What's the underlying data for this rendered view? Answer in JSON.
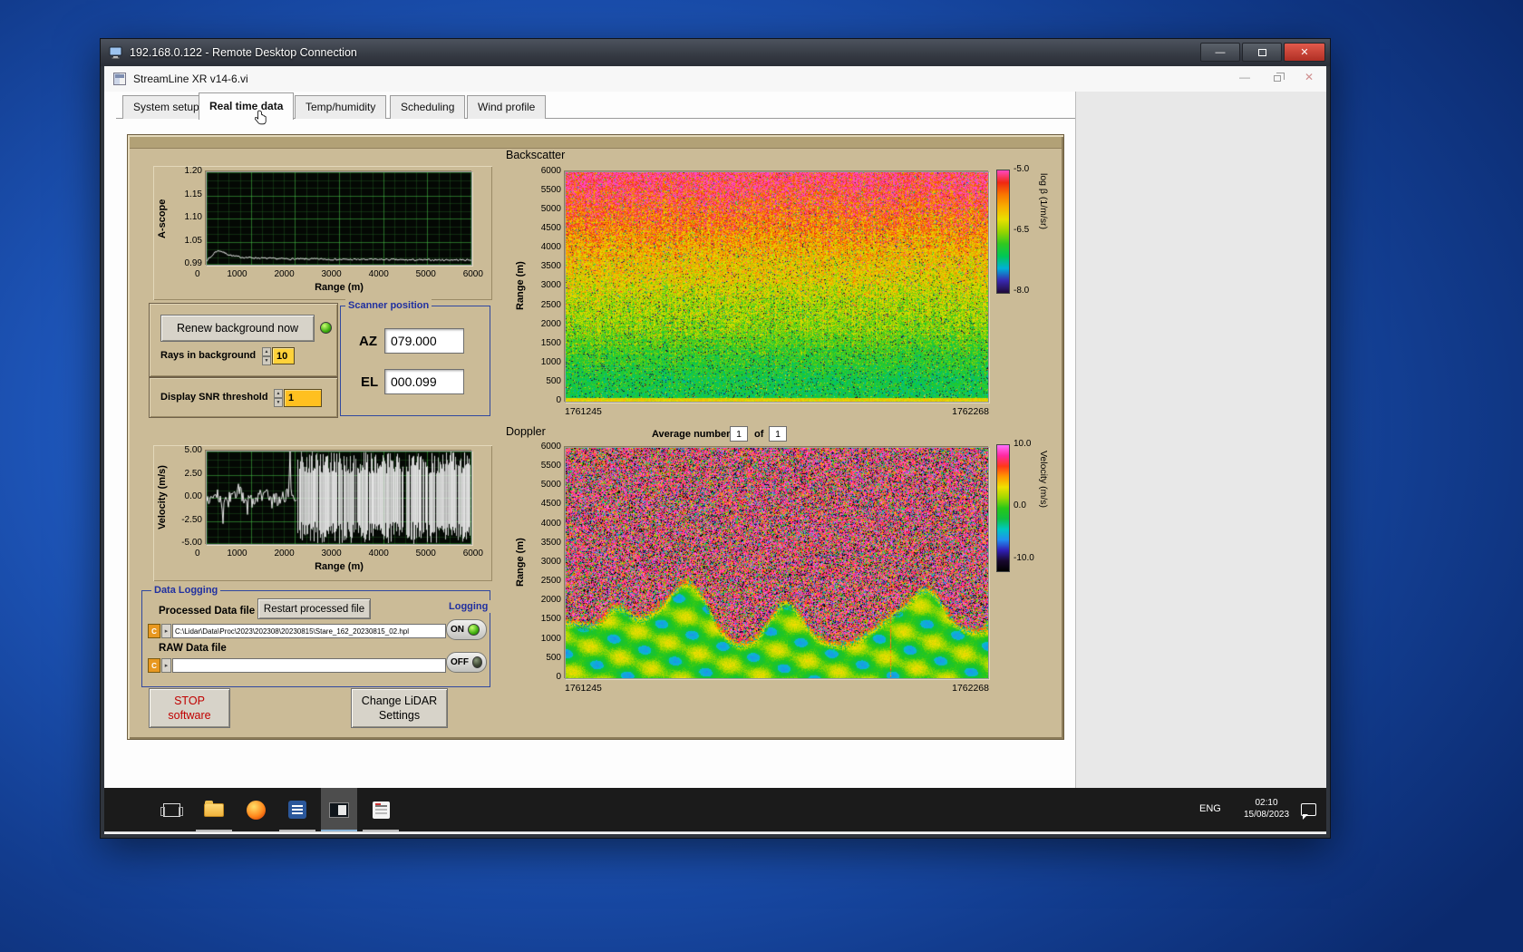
{
  "rdp": {
    "title": "192.168.0.122 - Remote Desktop Connection"
  },
  "app_window": {
    "title": "StreamLine XR v14-6.vi",
    "tabs": [
      "System setup",
      "Real time data",
      "Temp/humidity",
      "Scheduling",
      "Wind profile"
    ],
    "active_tab": "Real time data"
  },
  "panel": {
    "backscatter_title": "Backscatter",
    "doppler_title": "Doppler",
    "average_label": "Average number",
    "average_value": "1",
    "of_label": "of",
    "average_total": "1",
    "renew_button": "Renew background now",
    "rays_label": "Rays in background",
    "rays_value": "10",
    "snr_label": "Display SNR threshold",
    "snr_value": "1",
    "scanner": {
      "label": "Scanner position",
      "az_label": "AZ",
      "az_value": "079.000",
      "el_label": "EL",
      "el_value": "000.099"
    },
    "logging": {
      "box_label": "Data Logging",
      "processed_label": "Processed Data file",
      "restart_button": "Restart processed file",
      "logging_label": "Logging",
      "drive_letter": "C",
      "processed_path": "C:\\Lidar\\Data\\Proc\\2023\\202308\\20230815\\Stare_162_20230815_02.hpl",
      "raw_label": "RAW Data file",
      "raw_path": "",
      "on_label": "ON",
      "off_label": "OFF"
    },
    "stop_button_line1": "STOP",
    "stop_button_line2": "software",
    "change_button_line1": "Change LiDAR",
    "change_button_line2": "Settings"
  },
  "taskbar": {
    "language": "ENG",
    "time": "02:10",
    "date": "15/08/2023"
  },
  "chart_data": [
    {
      "id": "ascope",
      "type": "line",
      "ylabel": "A-scope",
      "xlabel": "Range (m)",
      "xlim": [
        0,
        6000
      ],
      "ylim": [
        0.99,
        1.2
      ],
      "xtick_labels": [
        "0",
        "1000",
        "2000",
        "3000",
        "4000",
        "5000",
        "6000"
      ],
      "ytick_labels": [
        "1.20",
        "1.15",
        "1.10",
        "1.05",
        "0.99"
      ],
      "x": [
        0,
        100,
        200,
        300,
        400,
        500,
        600,
        800,
        1000,
        1250,
        1500,
        2000,
        2500,
        3000,
        3500,
        4000,
        4500,
        5000,
        5500,
        6000
      ],
      "y": [
        1.0,
        1.008,
        1.02,
        1.022,
        1.017,
        1.013,
        1.01,
        1.007,
        1.006,
        1.005,
        1.004,
        1.003,
        1.003,
        1.002,
        1.002,
        1.002,
        1.001,
        1.001,
        1.001,
        1.001
      ],
      "line_color": "#e6e6e6",
      "bg": "#040804",
      "grid": true
    },
    {
      "id": "velocity",
      "type": "line",
      "ylabel": "Velocity (m/s)",
      "xlabel": "Range (m)",
      "xlim": [
        0,
        6000
      ],
      "ylim": [
        -5,
        5
      ],
      "xtick_labels": [
        "0",
        "1000",
        "2000",
        "3000",
        "4000",
        "5000",
        "6000"
      ],
      "ytick_labels": [
        "5.00",
        "2.50",
        "0.00",
        "-2.50",
        "-5.00"
      ],
      "segments": [
        {
          "x_range": [
            0,
            2050
          ],
          "mode": "low-noise",
          "mean": 0,
          "amplitude": 1.6,
          "spikes": [
            {
              "x": 380,
              "y": -2.8
            },
            {
              "x": 1900,
              "y": 5.0
            }
          ]
        },
        {
          "x_range": [
            2050,
            6000
          ],
          "mode": "saturated",
          "amplitude": 5.0,
          "fill_density": 0.88
        }
      ],
      "line_color": "#e8e8e8",
      "bg": "#040804",
      "grid": true
    },
    {
      "id": "backscatter",
      "type": "heatmap",
      "title": "Backscatter",
      "ylabel": "Range (m)",
      "ylim": [
        0,
        6000
      ],
      "ytick_labels": [
        "6000",
        "5500",
        "5000",
        "4500",
        "4000",
        "3500",
        "3000",
        "2500",
        "2000",
        "1500",
        "1000",
        "500",
        "0"
      ],
      "x_start_label": "1761245",
      "x_end_label": "1762268",
      "colorbar": {
        "label": "log β (1/m/sr)",
        "tick_labels": [
          "-5.0",
          "-6.5",
          "-8.0"
        ],
        "vmax": -5.0,
        "vmin": -8.0,
        "stops": [
          "#200a38",
          "#3828b0",
          "#00b0d8",
          "#00c855",
          "#30c820",
          "#98d400",
          "#e8e000",
          "#f8b000",
          "#f87800",
          "#f02810",
          "#ff48c0"
        ]
      },
      "profile": {
        "alt_fraction": [
          0,
          0.15,
          0.3,
          0.45,
          0.6,
          0.75,
          0.88,
          1.0
        ],
        "logB": [
          -7.1,
          -6.9,
          -6.6,
          -6.35,
          -6.05,
          -5.7,
          -5.35,
          -5.05
        ]
      },
      "surface_band_logB": -6.15,
      "noise_sigma": 0.6,
      "description": "Noise-dominated backscatter: ~-5 (red/magenta) at 6000 m grading through orange/yellow to green (~-7) near surface; thin bright yellow-orange band at 0 m"
    },
    {
      "id": "doppler",
      "type": "heatmap",
      "title": "Doppler",
      "ylabel": "Range (m)",
      "ylim": [
        0,
        6000
      ],
      "ytick_labels": [
        "6000",
        "5500",
        "5000",
        "4500",
        "4000",
        "3500",
        "3000",
        "2500",
        "2000",
        "1500",
        "1000",
        "500",
        "0"
      ],
      "x_start_label": "1761245",
      "x_end_label": "1762268",
      "colorbar": {
        "label": "Velocity (m/s)",
        "tick_labels": [
          "10.0",
          "0.0",
          "-10.0"
        ],
        "vmax": 10.0,
        "vmin": -10.0,
        "stops": [
          "#000000",
          "#180830",
          "#3020b8",
          "#2090f0",
          "#00c8c0",
          "#10c040",
          "#28c818",
          "#a0d800",
          "#f0e000",
          "#ff9800",
          "#ff3818",
          "#ff28a0",
          "#ff70ff"
        ]
      },
      "boundary_layer_m": 1500,
      "description": "Random-velocity noise (magenta/pink speckle) above the boundary layer; coherent aerosol returns below ~1500 m with velocities ~0 to -5 m/s (green with blue patches); thin vertical updraft streak near right side"
    }
  ]
}
